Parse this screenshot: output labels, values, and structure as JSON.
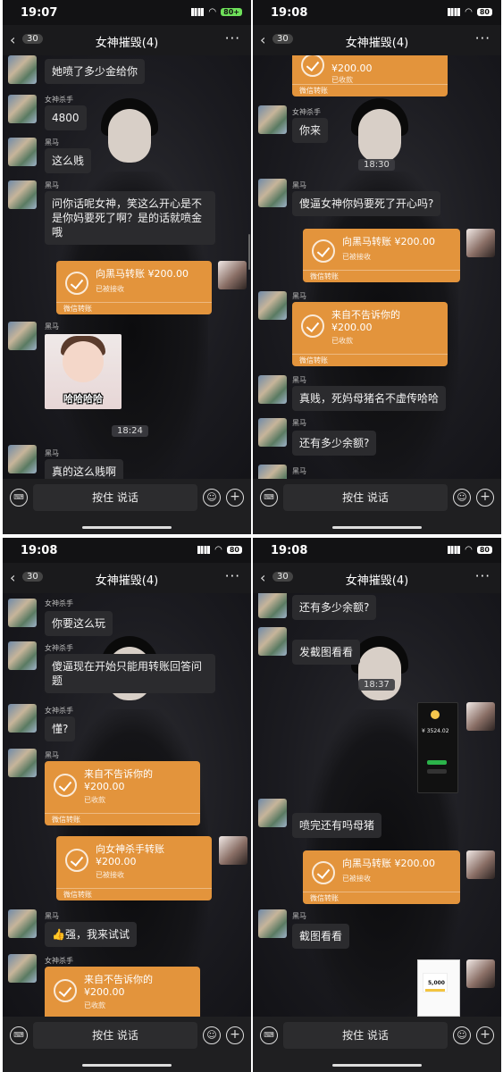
{
  "status_bar": {
    "p1_time": "19:07",
    "p1_battery": "80+",
    "p2_time": "19:08",
    "p2_battery": "80",
    "p3_time": "19:08",
    "p3_battery": "80",
    "p4_time": "19:08",
    "p4_battery": "80"
  },
  "header": {
    "back_count": "30",
    "title": "女神摧毁(4)",
    "more_icon": "more-dots-icon"
  },
  "input_bar": {
    "talk_label": "按住 说话",
    "icons": [
      "voice-keyboard-icon",
      "emoji-icon",
      "plus-icon"
    ]
  },
  "names": {
    "killer": "女神杀手",
    "horse": "黑马"
  },
  "transfer": {
    "amount": "¥200.00",
    "received": "已收款",
    "accepted": "已被接收",
    "source": "微信转账",
    "to_horse": "向黑马转账",
    "to_killer": "向女神杀手转账",
    "from_secret": "来自不告诉你的"
  },
  "panel1": {
    "m1": "她喷了多少金给你",
    "m2": "4800",
    "m3": "这么贱",
    "m4": "问你话呢女神，笑这么开心是不是你妈要死了啊？是的话就喷金哦",
    "sticker_caption": "哈哈哈哈",
    "time": "18:24",
    "m5": "真的这么贱啊"
  },
  "panel2": {
    "m1": "你来",
    "time": "18:30",
    "m2": "傻逼女神你妈要死了开心吗?",
    "m3": "真贱，死妈母猪名不虚传哈哈",
    "m4": "还有多少余额?"
  },
  "panel3": {
    "m1": "你要这么玩",
    "m2": "傻逼现在开始只能用转账回答问题",
    "m3": "懂?",
    "m4": "👍强，我来试试"
  },
  "panel4": {
    "m1": "还有多少余额?",
    "m2": "发截图看看",
    "time": "18:37",
    "shot_amount": "¥ 3524.02",
    "m3": "喷完还有吗母猪",
    "m4": "截图看看",
    "shot2_amount": "5,000"
  }
}
